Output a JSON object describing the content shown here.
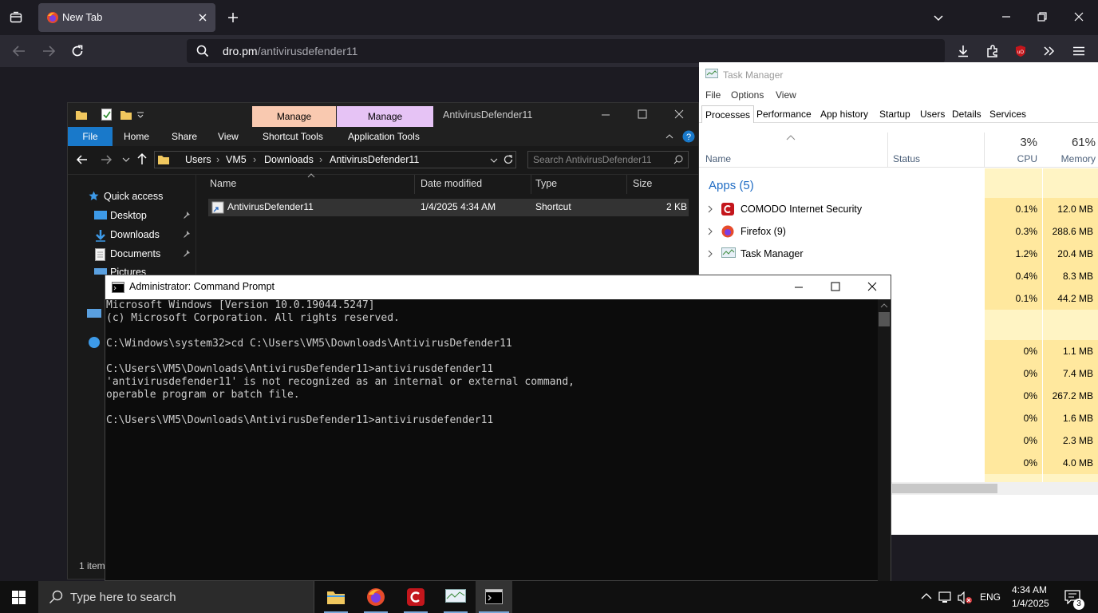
{
  "browser": {
    "tab_title": "New Tab",
    "url_host": "dro.pm",
    "url_path": "/antivirusdefender11"
  },
  "task_manager": {
    "title": "Task Manager",
    "menu": [
      "File",
      "Options",
      "View"
    ],
    "tabs": [
      "Processes",
      "Performance",
      "App history",
      "Startup",
      "Users",
      "Details",
      "Services"
    ],
    "active_tab": "Processes",
    "columns": {
      "name": "Name",
      "status": "Status",
      "cpu_pct": "3%",
      "cpu": "CPU",
      "mem_pct": "61%",
      "memory": "Memory"
    },
    "group_label": "Apps (5)",
    "rows": [
      {
        "name": "COMODO Internet Security",
        "cpu": "0.1%",
        "mem": "12.0 MB"
      },
      {
        "name": "Firefox (9)",
        "cpu": "0.3%",
        "mem": "288.6 MB"
      },
      {
        "name": "Task Manager",
        "cpu": "1.2%",
        "mem": "20.4 MB"
      },
      {
        "name": "",
        "cpu": "0.4%",
        "mem": "8.3 MB"
      },
      {
        "name": "",
        "cpu": "0.1%",
        "mem": "44.2 MB"
      }
    ],
    "bg_rows": [
      {
        "cpu": "0%",
        "mem": "1.1 MB"
      },
      {
        "cpu": "0%",
        "mem": "7.4 MB"
      },
      {
        "cpu": "0%",
        "mem": "267.2 MB"
      },
      {
        "cpu": "0%",
        "mem": "1.6 MB"
      },
      {
        "cpu": "0%",
        "mem": "2.3 MB"
      },
      {
        "cpu": "0%",
        "mem": "4.0 MB"
      }
    ]
  },
  "explorer": {
    "manage_shortcut": "Manage",
    "manage_app": "Manage",
    "title": "AntivirusDefender11",
    "ribbon": {
      "file": "File",
      "home": "Home",
      "share": "Share",
      "view": "View",
      "shortcut_tools": "Shortcut Tools",
      "application_tools": "Application Tools"
    },
    "breadcrumb": [
      "Users",
      "VM5",
      "Downloads",
      "AntivirusDefender11"
    ],
    "search_placeholder": "Search AntivirusDefender11",
    "nav": {
      "quick_access": "Quick access",
      "desktop": "Desktop",
      "downloads": "Downloads",
      "documents": "Documents",
      "pictures": "Pictures"
    },
    "columns": {
      "name": "Name",
      "date": "Date modified",
      "type": "Type",
      "size": "Size"
    },
    "file": {
      "name": "AntivirusDefender11",
      "date": "1/4/2025 4:34 AM",
      "type": "Shortcut",
      "size": "2 KB"
    },
    "status": "1 item"
  },
  "cmd": {
    "title": "Administrator: Command Prompt",
    "output": "Microsoft Windows [Version 10.0.19044.5247]\n(c) Microsoft Corporation. All rights reserved.\n\nC:\\Windows\\system32>cd C:\\Users\\VM5\\Downloads\\AntivirusDefender11\n\nC:\\Users\\VM5\\Downloads\\AntivirusDefender11>antivirusdefender11\n'antivirusdefender11' is not recognized as an internal or external command,\noperable program or batch file.\n\nC:\\Users\\VM5\\Downloads\\AntivirusDefender11>antivirusdefender11"
  },
  "taskbar": {
    "search_placeholder": "Type here to search",
    "language": "ENG",
    "time": "4:34 AM",
    "date": "1/4/2025",
    "notification_count": "3"
  },
  "colors": {
    "firefox_dark": "#1c1b22",
    "firefox_toolbar": "#2b2a33",
    "explorer_file_tab": "#1979ca",
    "manage_shortcut_tab": "#f9c9b0",
    "manage_app_tab": "#e6c3f5",
    "tm_group_blue": "#1f6cc4",
    "tm_heat": "#ffe89e"
  }
}
